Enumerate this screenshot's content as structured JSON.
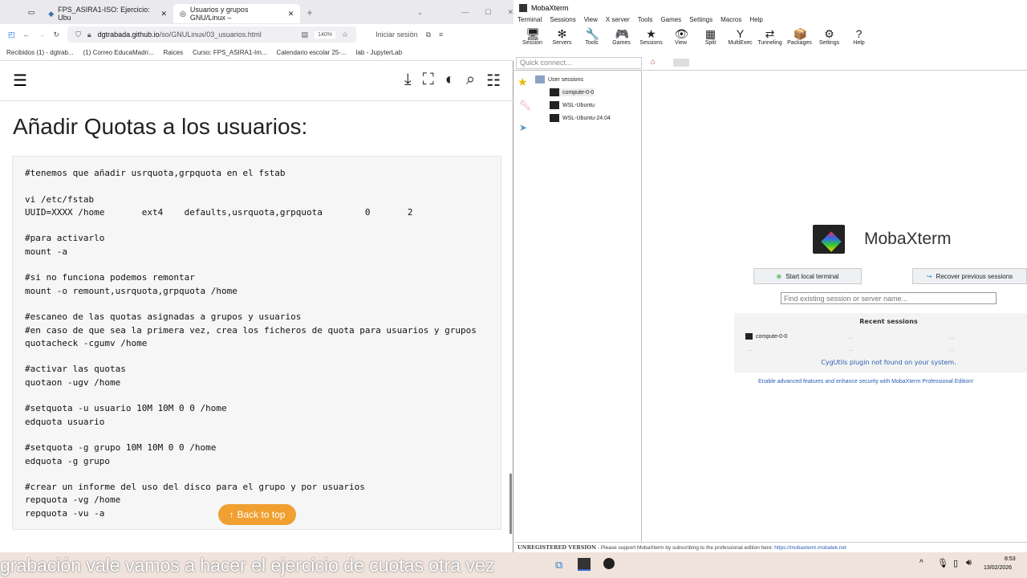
{
  "browser": {
    "tabs": [
      {
        "label": "FPS_ASIRA1-ISO: Ejercicio: Ubu"
      },
      {
        "label": "Usuarios y grupos GNU/Linux –"
      }
    ],
    "url_domain": "dgtrabada.github.io",
    "url_path": "/so/GNULinux/03_usuarios.html",
    "zoom": "140%",
    "signin": "Iniciar sesión",
    "bookmarks": [
      "Recibidos (1) - dgtrab...",
      "(1) Correo EducaMadri...",
      "Raices",
      "Curso: FPS_ASIRA1-Im...",
      "Calendario escolar 25-...",
      "lab - JupyterLab"
    ]
  },
  "page": {
    "heading": "Añadir Quotas a los usuarios:",
    "code": "#tenemos que añadir usrquota,grpquota en el fstab\n\nvi /etc/fstab\nUUID=XXXX /home       ext4    defaults,usrquota,grpquota        0       2\n\n#para activarlo\nmount -a\n\n#si no funciona podemos remontar\nmount -o remount,usrquota,grpquota /home\n\n#escaneo de las quotas asignadas a grupos y usuarios\n#en caso de que sea la primera vez, crea los ficheros de quota para usuarios y grupos\nquotacheck -cgumv /home\n\n#activar las quotas\nquotaon -ugv /home\n\n#setquota -u usuario 10M 10M 0 0 /home\nedquota usuario\n\n#setquota -g grupo 10M 10M 0 0 /home\nedquota -g grupo\n\n#crear un informe del uso del disco para el grupo y por usuarios\nrepquota -vg /home\nrepquota -vu -a",
    "back_to_top": "Back to top"
  },
  "moba": {
    "title": "MobaXterm",
    "menu": [
      "Terminal",
      "Sessions",
      "View",
      "X server",
      "Tools",
      "Games",
      "Settings",
      "Macros",
      "Help"
    ],
    "tools": [
      {
        "label": "Session",
        "icon": "🖥"
      },
      {
        "label": "Servers",
        "icon": "✻"
      },
      {
        "label": "Tools",
        "icon": "🔧"
      },
      {
        "label": "Games",
        "icon": "🎮"
      },
      {
        "label": "Sessions",
        "icon": "★"
      },
      {
        "label": "View",
        "icon": "👁"
      },
      {
        "label": "Split",
        "icon": "▦"
      },
      {
        "label": "MultiExec",
        "icon": "Y"
      },
      {
        "label": "Tunneling",
        "icon": "⇄"
      },
      {
        "label": "Packages",
        "icon": "📦"
      },
      {
        "label": "Settings",
        "icon": "⚙"
      },
      {
        "label": "Help",
        "icon": "?"
      }
    ],
    "quick_connect": "Quick connect...",
    "tree_root": "User sessions",
    "sessions": [
      "compute-0-0",
      "WSL-Ubuntu",
      "WSL-Ubuntu-24.04"
    ],
    "app_name": "MobaXterm",
    "start_terminal": "Start local terminal",
    "recover": "Recover previous sessions",
    "find_placeholder": "Find existing session or server name...",
    "recent_title": "Recent sessions",
    "recent": [
      "compute-0-0",
      "...",
      "...",
      "...",
      "...",
      "..."
    ],
    "cygutils": "CygUtils plugin not found on your system.",
    "promo": "Enable advanced features and enhance security with MobaXterm Professional Edition!",
    "status_bold": "UNREGISTERED VERSION",
    "status_text": " - Please support MobaXterm by subscribing to the professional edition here: ",
    "status_link": "https://mobaxterm.mobatek.net"
  },
  "taskbar": {
    "caption": "grabación vale vamos a hacer el ejercicio de cuotas otra vez",
    "time": "8:53",
    "date": "13/02/2026"
  }
}
